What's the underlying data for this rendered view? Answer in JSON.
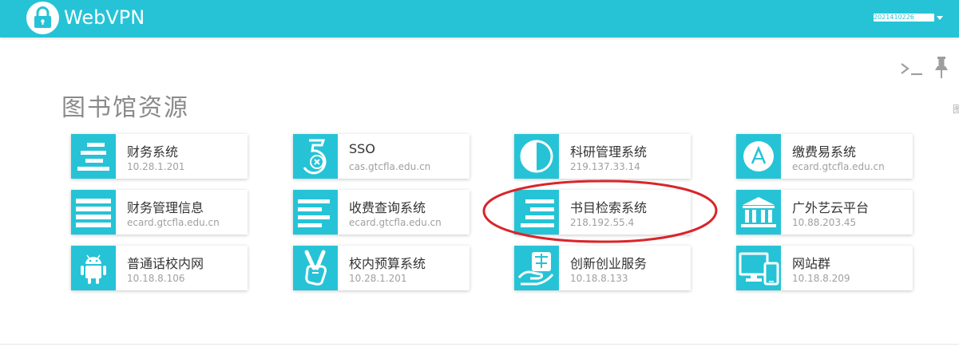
{
  "navbar": {
    "brand": "WebVPN",
    "user_name": "2021410226",
    "colors": {
      "bar": "#26c3d6",
      "text": "#ffffff"
    }
  },
  "toolbar": {
    "terminal_icon": "terminal-icon",
    "pin_icon": "pin-icon"
  },
  "edge_text": "图",
  "section": {
    "title": "图书馆资源"
  },
  "cards": [
    {
      "name": "财务系统",
      "addr": "10.28.1.201",
      "icon": "list-align-icon"
    },
    {
      "name": "SSO",
      "addr": "cas.gtcfla.edu.cn",
      "icon": "sso-five-icon"
    },
    {
      "name": "科研管理系统",
      "addr": "219.137.33.14",
      "icon": "half-circle-icon"
    },
    {
      "name": "缴费易系统",
      "addr": "ecard.gtcfla.edu.cn",
      "icon": "triangle-circle-icon"
    },
    {
      "name": "财务管理信息",
      "addr": "ecard.gtcfla.edu.cn",
      "icon": "list-lines-icon"
    },
    {
      "name": "收费查询系统",
      "addr": "ecard.gtcfla.edu.cn",
      "icon": "list-left-icon"
    },
    {
      "name": "书目检索系统",
      "addr": "218.192.55.4",
      "icon": "list-right-icon"
    },
    {
      "name": "广外艺云平台",
      "addr": "10.88.203.45",
      "icon": "bank-icon"
    },
    {
      "name": "普通话校内网",
      "addr": "10.18.8.106",
      "icon": "android-icon"
    },
    {
      "name": "校内预算系统",
      "addr": "10.28.1.201",
      "icon": "victory-hand-icon"
    },
    {
      "name": "创新创业服务",
      "addr": "10.18.8.133",
      "icon": "tax-hand-icon"
    },
    {
      "name": "网站群",
      "addr": "10.18.8.209",
      "icon": "devices-icon"
    }
  ],
  "annotation": {
    "color": "#d9252a",
    "target": "书目检索系统"
  }
}
